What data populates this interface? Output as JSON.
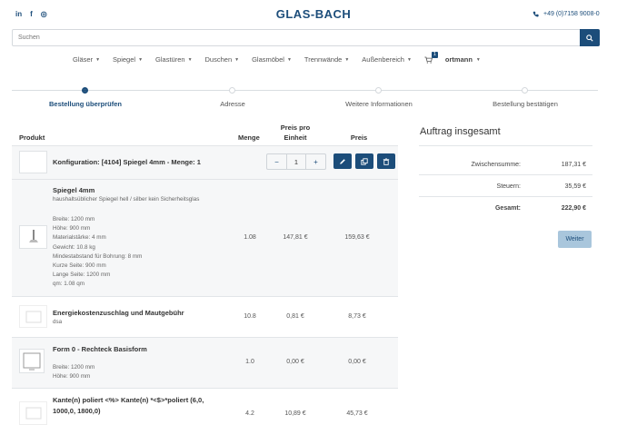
{
  "header": {
    "social": [
      "in",
      "f",
      "◎"
    ],
    "logo": "GLAS-BACH",
    "phone": "+49 (0)7158 9008-0"
  },
  "search": {
    "placeholder": "Suchen"
  },
  "nav": {
    "items": [
      "Gläser",
      "Spiegel",
      "Glastüren",
      "Duschen",
      "Glasmöbel",
      "Trennwände",
      "Außenbereich"
    ],
    "cart_count": "1",
    "user": "ortmann"
  },
  "steps": [
    {
      "label": "Bestellung überprüfen",
      "active": true
    },
    {
      "label": "Adresse",
      "active": false
    },
    {
      "label": "Weitere Informationen",
      "active": false
    },
    {
      "label": "Bestellung bestätigen",
      "active": false
    }
  ],
  "table": {
    "headers": {
      "product": "Produkt",
      "qty": "Menge",
      "price_a": "Preis pro",
      "price_b": "Einheit",
      "price": "Preis"
    },
    "config": {
      "title": "Konfiguration: [4104] Spiegel 4mm - Menge: 1",
      "qty": "1"
    },
    "rows": [
      {
        "title": "Spiegel 4mm",
        "subtitle": "haushaltsüblicher Spiegel hell / silber kein Sicherheitsglas",
        "details": [
          "Breite: 1200 mm",
          "Höhe: 900 mm",
          "Materialstärke: 4 mm",
          "Gewicht: 10.8 kg",
          "Mindestabstand für Bohrung: 8 mm",
          "Kurze Seite: 900 mm",
          "Lange Seite: 1200 mm",
          "qm: 1.08 qm"
        ],
        "qty": "1.08",
        "unit": "147,81 €",
        "price": "159,63 €"
      },
      {
        "title": "Energiekostenzuschlag und Mautgebühr",
        "subtitle": "dsa",
        "details": [],
        "qty": "10.8",
        "unit": "0,81 €",
        "price": "8,73 €"
      },
      {
        "title": "Form 0 - Rechteck Basisform",
        "subtitle": "",
        "details": [
          "Breite: 1200 mm",
          "Höhe: 900 mm"
        ],
        "qty": "1.0",
        "unit": "0,00 €",
        "price": "0,00 €"
      },
      {
        "title": "Kante(n) poliert <%> Kante(n) *<$>*poliert (6,0, 1000,0, 1800,0)",
        "subtitle": "",
        "details": [],
        "qty": "4.2",
        "unit": "10,89 €",
        "price": "45,73 €"
      }
    ]
  },
  "summary": {
    "title": "Auftrag insgesamt",
    "subtotal_label": "Zwischensumme:",
    "subtotal": "187,31 €",
    "tax_label": "Steuern:",
    "tax": "35,59 €",
    "total_label": "Gesamt:",
    "total": "222,90 €",
    "button": "Weiter"
  },
  "colors": {
    "primary": "#1c4d7a",
    "button_light": "#a9c6dc"
  }
}
